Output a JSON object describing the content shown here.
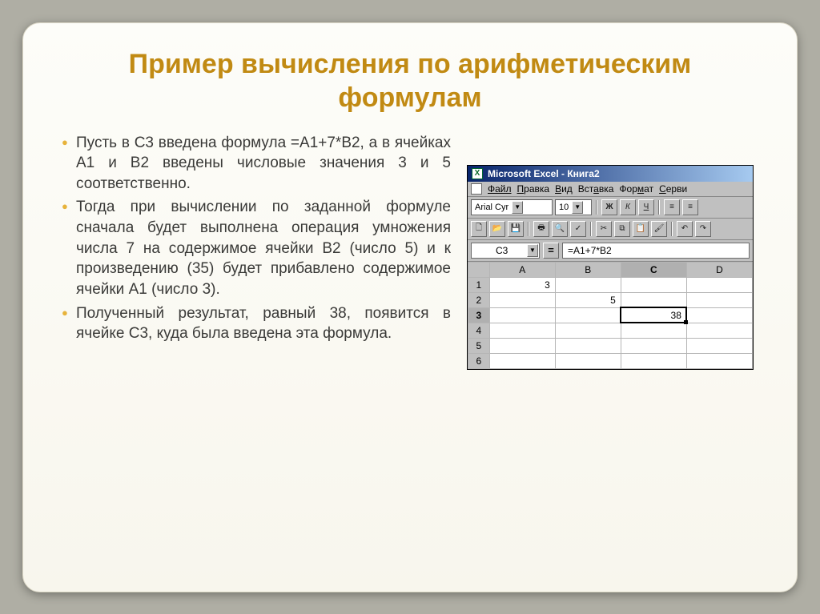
{
  "slide": {
    "title": "Пример вычисления по арифметическим формулам",
    "bullets": [
      "Пусть в C3 введена формула =A1+7*B2, а в ячейках A1 и B2 введены числовые значения 3 и 5 соответственно.",
      "Тогда при вычислении по заданной формуле сначала будет выполнена операция умножения числа 7 на содержимое ячейки B2 (число 5) и к произведению (35) будет прибавлено содержимое ячейки A1 (число 3).",
      "Полученный результат, равный 38, появится в ячейке C3, куда была введена эта формула."
    ]
  },
  "excel": {
    "title": "Microsoft Excel - Книга2",
    "menu": [
      "Файл",
      "Правка",
      "Вид",
      "Вставка",
      "Формат",
      "Серви"
    ],
    "font_name": "Arial Cyr",
    "font_size": "10",
    "style_buttons": [
      "Ж",
      "К",
      "Ч"
    ],
    "name_box": "C3",
    "formula": "=A1+7*B2",
    "columns": [
      "A",
      "B",
      "C",
      "D"
    ],
    "rows": [
      {
        "n": "1",
        "A": "3",
        "B": "",
        "C": "",
        "D": ""
      },
      {
        "n": "2",
        "A": "",
        "B": "5",
        "C": "",
        "D": ""
      },
      {
        "n": "3",
        "A": "",
        "B": "",
        "C": "38",
        "D": ""
      },
      {
        "n": "4",
        "A": "",
        "B": "",
        "C": "",
        "D": ""
      },
      {
        "n": "5",
        "A": "",
        "B": "",
        "C": "",
        "D": ""
      },
      {
        "n": "6",
        "A": "",
        "B": "",
        "C": "",
        "D": ""
      }
    ],
    "active_cell": "C3"
  }
}
